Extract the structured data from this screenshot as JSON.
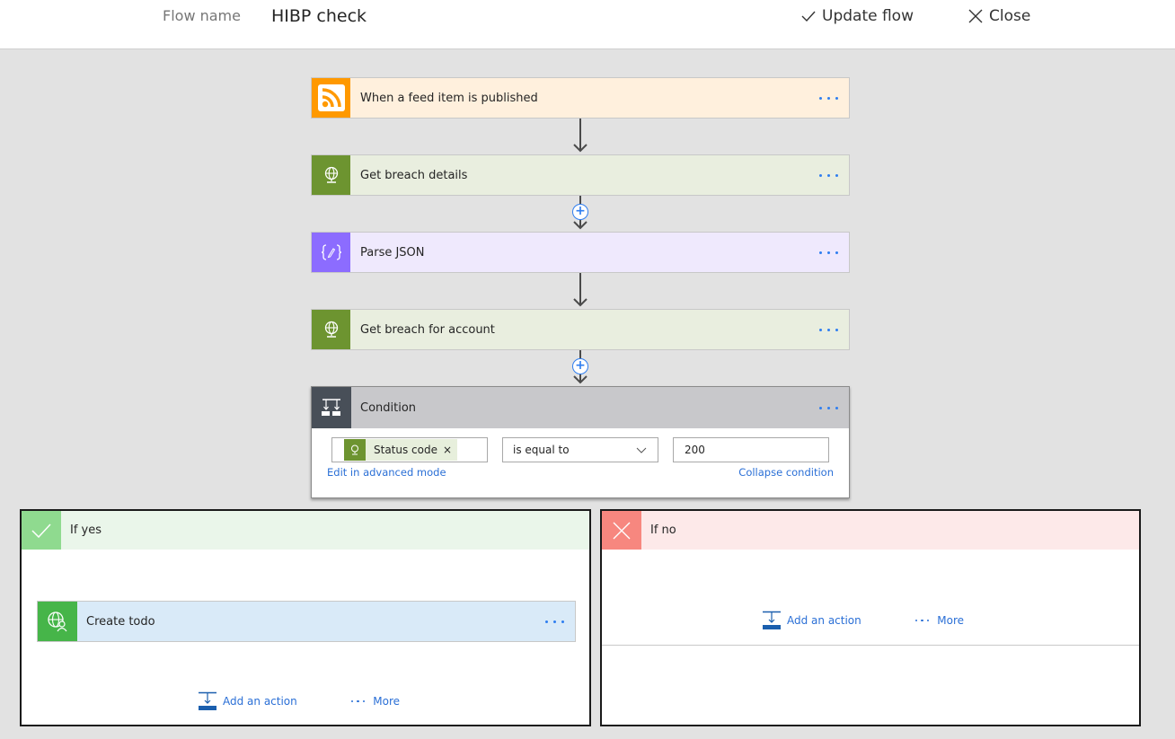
{
  "header": {
    "flow_name_label": "Flow name",
    "flow_name_value": "HIBP check",
    "update_label": "Update flow",
    "close_label": "Close"
  },
  "steps": [
    {
      "title": "When a feed item is published",
      "icon": "rss-icon",
      "color": "#ff9900",
      "bg": "#fff0dd"
    },
    {
      "title": "Get breach details",
      "icon": "globe-icon",
      "color": "#6d9430",
      "bg": "#e9eedf"
    },
    {
      "title": "Parse JSON",
      "icon": "json-icon",
      "color": "#8c6cff",
      "bg": "#efe9fd"
    },
    {
      "title": "Get breach for account",
      "icon": "globe-icon",
      "color": "#6d9430",
      "bg": "#e9eedf"
    }
  ],
  "condition": {
    "title": "Condition",
    "token_label": "Status code",
    "token_remove": "×",
    "operator": "is equal to",
    "value": "200",
    "advanced_link": "Edit in advanced mode",
    "collapse_link": "Collapse condition"
  },
  "branch_yes": {
    "title": "If yes",
    "actions": [
      {
        "title": "Create todo"
      }
    ],
    "add_action_label": "Add an action",
    "more_label": "More"
  },
  "branch_no": {
    "title": "If no",
    "add_action_label": "Add an action",
    "more_label": "More"
  }
}
